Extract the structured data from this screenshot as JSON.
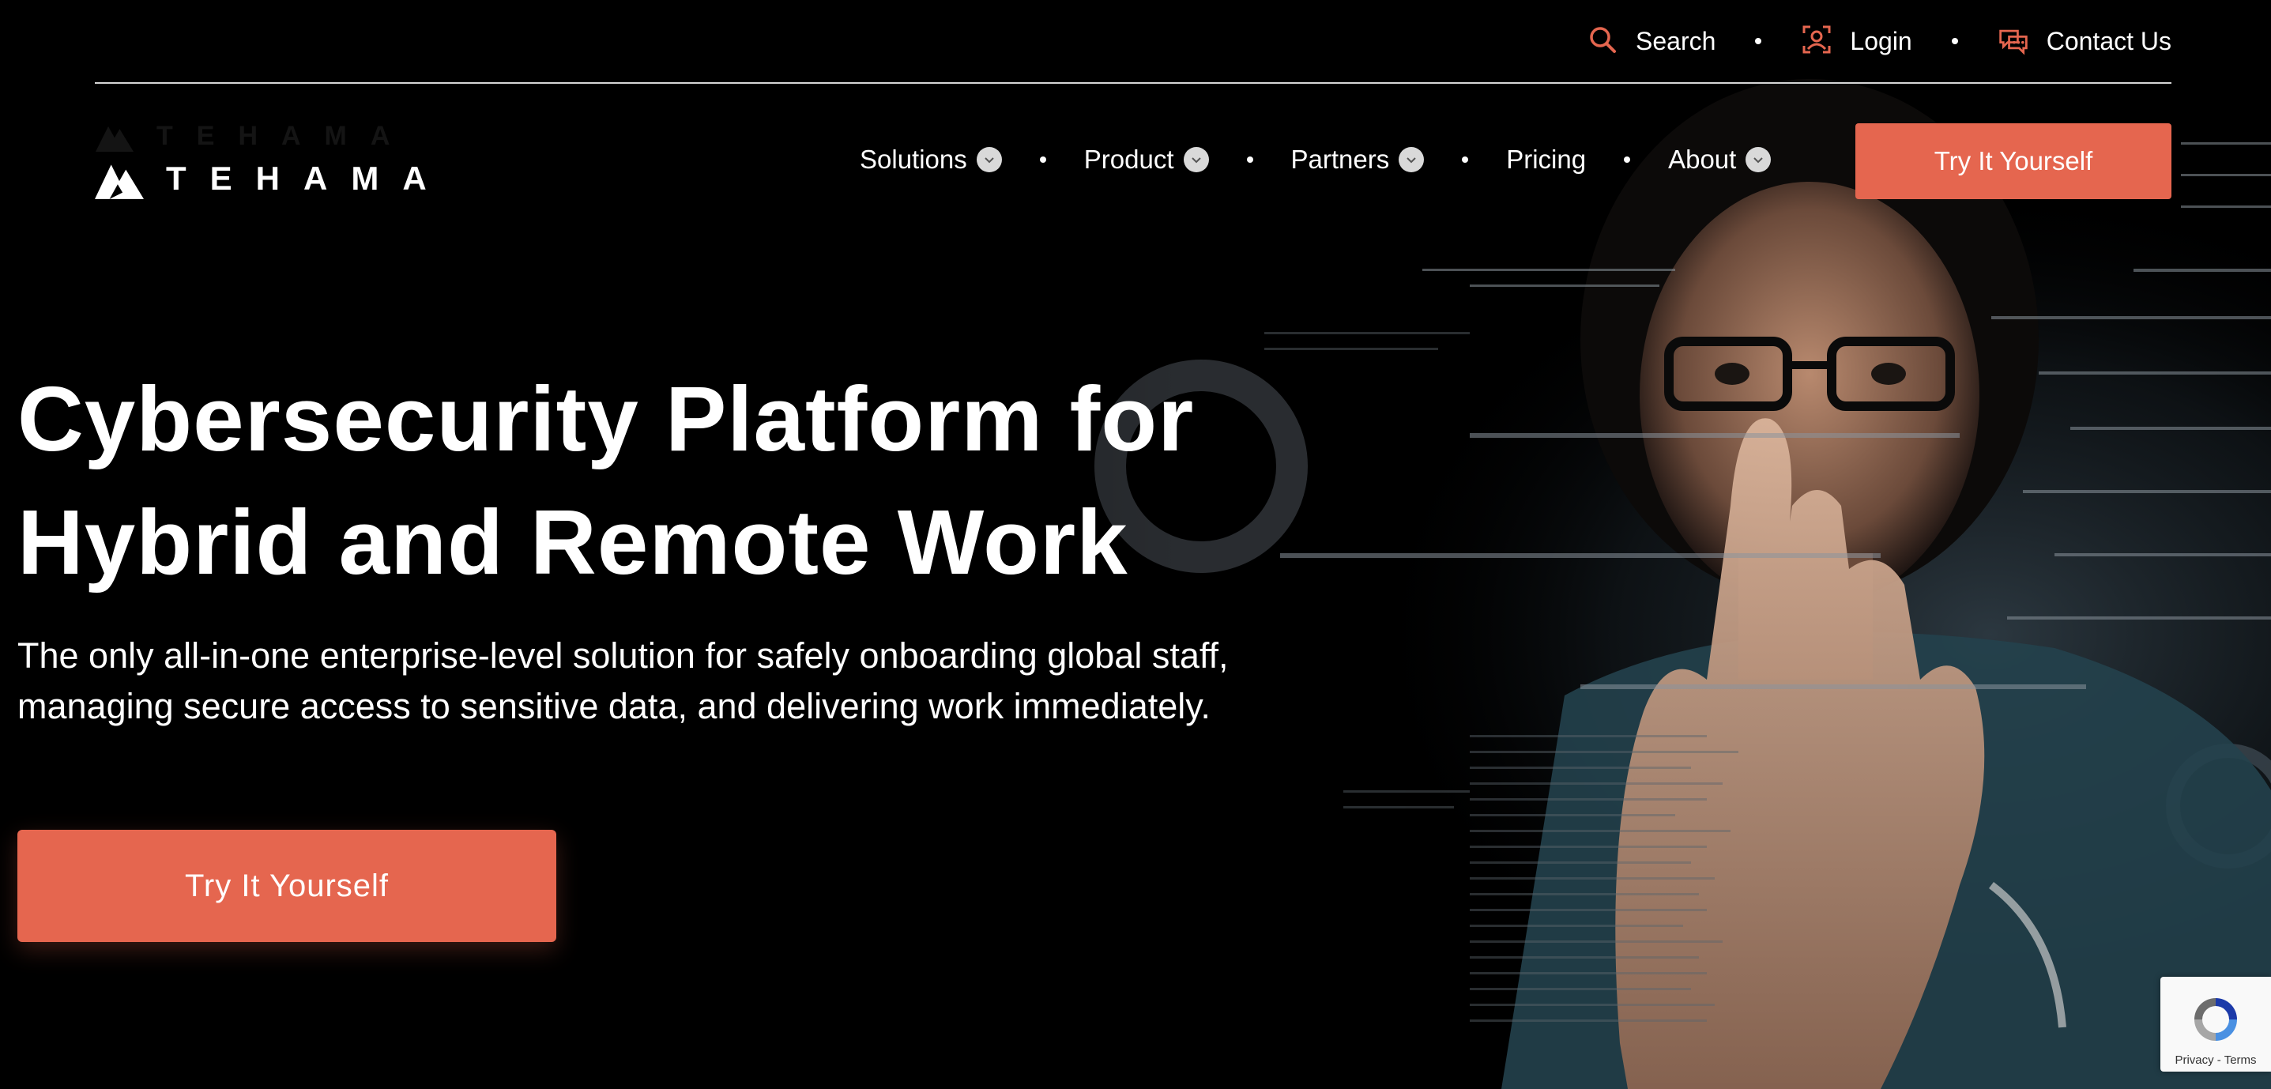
{
  "utility_bar": {
    "search_label": "Search",
    "login_label": "Login",
    "contact_label": "Contact Us",
    "icons": [
      "search-icon",
      "login-icon",
      "chat-bubble-icon"
    ]
  },
  "logo": {
    "wordmark": "TEHAMA"
  },
  "nav": {
    "items": [
      {
        "label": "Solutions",
        "has_dropdown": true
      },
      {
        "label": "Product",
        "has_dropdown": true
      },
      {
        "label": "Partners",
        "has_dropdown": true
      },
      {
        "label": "Pricing",
        "has_dropdown": false
      },
      {
        "label": "About",
        "has_dropdown": true
      }
    ],
    "cta_label": "Try It Yourself"
  },
  "hero": {
    "title_line1": "Cybersecurity Platform for",
    "title_line2": "Hybrid and Remote Work",
    "subtitle_line1": "The only all-in-one enterprise-level solution for safely onboarding global staff,",
    "subtitle_line2": "managing secure access to sensitive data, and delivering work immediately.",
    "cta_label": "Try It Yourself"
  },
  "recaptcha": {
    "privacy": "Privacy",
    "separator": " - ",
    "terms": "Terms"
  },
  "colors": {
    "accent": "#e5664f",
    "background": "#000000",
    "text": "#ffffff"
  }
}
